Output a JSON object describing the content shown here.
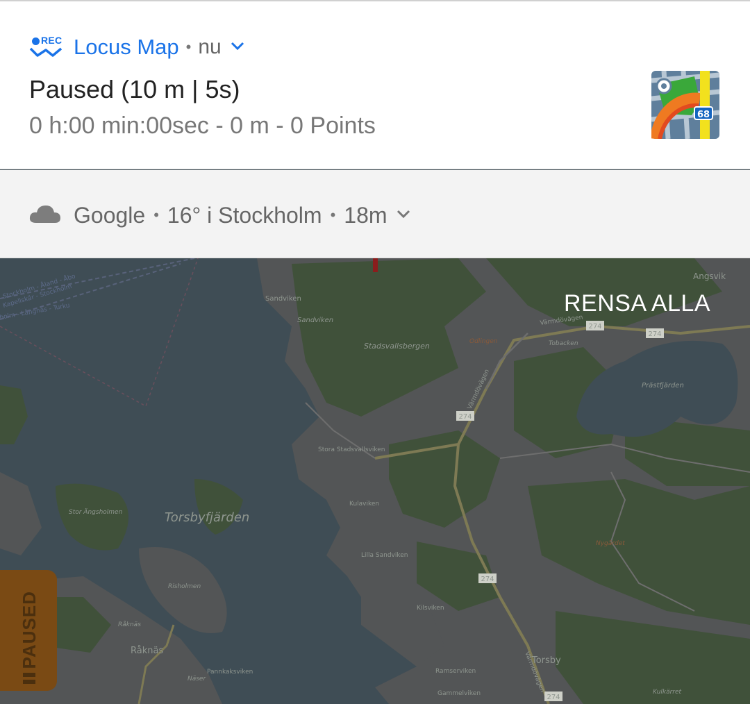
{
  "notification_locus": {
    "app_name": "Locus Map",
    "time": "nu",
    "rec_badge": "REC",
    "title": "Paused (10 m | 5s)",
    "subtitle": "0 h:00 min:00sec - 0 m - 0 Points",
    "badge_number": "68"
  },
  "notification_weather": {
    "source": "Google",
    "summary": "16° i Stockholm",
    "time": "18m"
  },
  "clear_all_label": "RENSA ALLA",
  "paused_tab": {
    "label": "PAUSED"
  },
  "map": {
    "labels": {
      "torsbyfjarden": "Torsbyfjärden",
      "stadsvallsbergen": "Stadsvallsbergen",
      "sandviken_1": "Sandviken",
      "sandviken_2": "Sandviken",
      "angsvik": "Angsvik",
      "varmdovagen_1": "Värmdövägen",
      "varmdovagen_2": "Värmdövägen",
      "varmdovagen_3": "Värmdövägen",
      "odlingen": "Odlingen",
      "tobacken": "Tobacken",
      "prastfjarden": "Prästfjärden",
      "stora_stadsvallsviken": "Stora Stadsvallsviken",
      "kulaviken": "Kulaviken",
      "lilla_sandviken": "Lilla Sandviken",
      "nygardet": "Nygärdet",
      "stor_angsholmen": "Stor Ängsholmen",
      "risholmen": "Risholmen",
      "raknas_1": "Råknäs",
      "raknas_2": "Råknäs",
      "kilsviken": "Kilsviken",
      "torsby": "Torsby",
      "ramserviken": "Ramserviken",
      "gammelviken": "Gammelviken",
      "pannkaksviken": "Pannkaksviken",
      "naser": "Näser",
      "kulkarret": "Kulkärret",
      "ferry": "Stockholm - Åland - Åbo",
      "ferry2": "Kapellskär - Stockholm",
      "ferry3": "holm - Långnäs - Turku"
    },
    "road_number": "274"
  },
  "colors": {
    "accent": "#1a73e8",
    "water": "#3f4d55",
    "forest": "#40513a",
    "land": "#535556",
    "paused_tab": "#7a4a14"
  }
}
